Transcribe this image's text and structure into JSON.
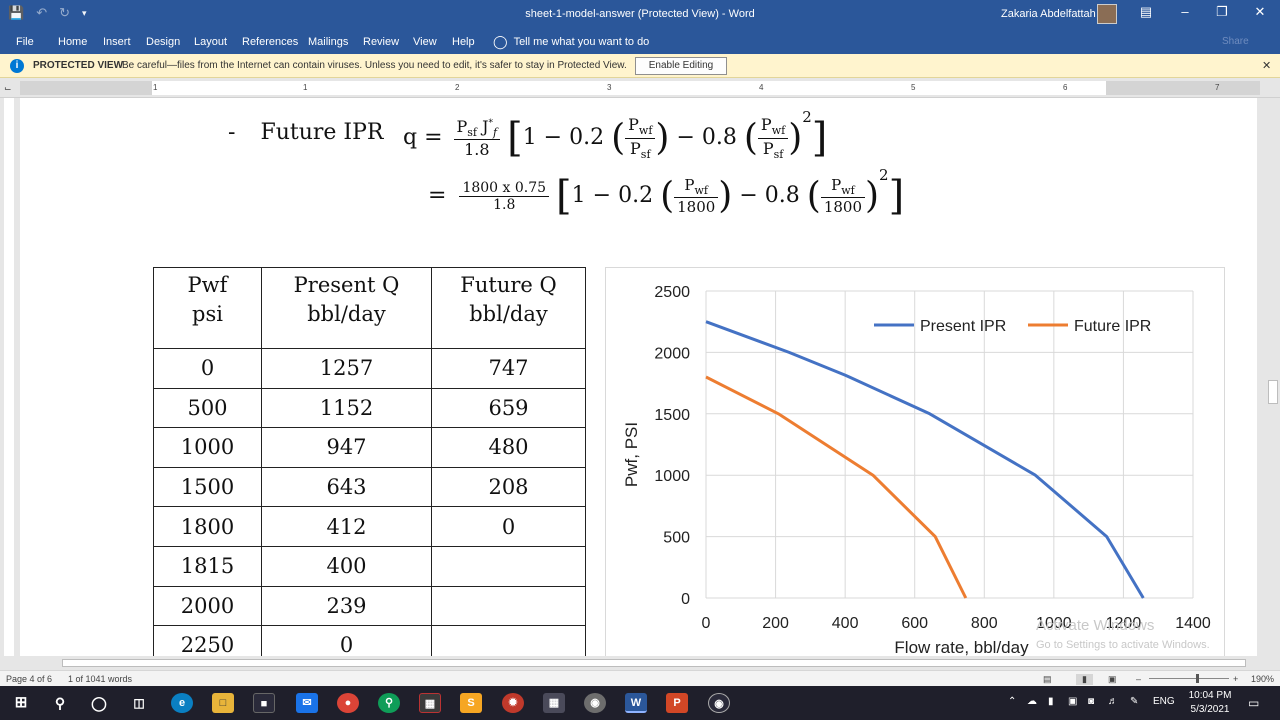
{
  "window": {
    "title": "sheet-1-model-answer (Protected View)  -  Word",
    "user": "Zakaria Abdelfattah"
  },
  "ribbon": {
    "tabs": [
      "File",
      "Home",
      "Insert",
      "Design",
      "Layout",
      "References",
      "Mailings",
      "Review",
      "View",
      "Help"
    ],
    "tell_me": "Tell me what you want to do",
    "share": "Share"
  },
  "protected_bar": {
    "label": "PROTECTED VIEW",
    "message": "Be careful—files from the Internet can contain viruses. Unless you need to edit, it's safer to stay in Protected View.",
    "enable_button": "Enable Editing"
  },
  "ruler": {
    "numbers": [
      "1",
      "1",
      "2",
      "3",
      "4",
      "5",
      "6",
      "7"
    ]
  },
  "document": {
    "bullet": "-",
    "heading": "Future IPR",
    "formula1": {
      "lhs": "q =",
      "num": "P",
      "num_sub": "sf",
      "num_var": " J",
      "num_star": "*",
      "num_f": "f",
      "den": "1.8",
      "body_a": "1 − 0.2",
      "body_b": "− 0.8",
      "ratio_num": "P",
      "ratio_num_sub": "wf",
      "ratio_den": "P",
      "ratio_den_sub": "sf",
      "power": "2"
    },
    "formula2": {
      "lhs": "=",
      "num": "1800 x 0.75",
      "den": "1.8",
      "body_a": "1 − 0.2",
      "body_b": "− 0.8",
      "ratio_num": "P",
      "ratio_num_sub": "wf",
      "ratio_den": "1800",
      "power": "2"
    },
    "table": {
      "headers": [
        [
          "Pwf",
          "psi"
        ],
        [
          "Present Q",
          "bbl/day"
        ],
        [
          "Future Q",
          "bbl/day"
        ]
      ],
      "rows": [
        [
          "0",
          "1257",
          "747"
        ],
        [
          "500",
          "1152",
          "659"
        ],
        [
          "1000",
          "947",
          "480"
        ],
        [
          "1500",
          "643",
          "208"
        ],
        [
          "1800",
          "412",
          "0"
        ],
        [
          "1815",
          "400",
          ""
        ],
        [
          "2000",
          "239",
          ""
        ],
        [
          "2250",
          "0",
          ""
        ]
      ]
    }
  },
  "chart_data": {
    "type": "line",
    "title": "",
    "xlabel": "Flow rate, bbl/day",
    "ylabel": "Pwf, PSI",
    "xlim": [
      0,
      1400
    ],
    "ylim": [
      0,
      2500
    ],
    "xticks": [
      0,
      200,
      400,
      600,
      800,
      1000,
      1200,
      1400
    ],
    "yticks": [
      0,
      500,
      1000,
      1500,
      2000,
      2500
    ],
    "grid": true,
    "legend": "top-right",
    "series": [
      {
        "name": "Present IPR",
        "color": "#4472c4",
        "points": [
          [
            0,
            2250
          ],
          [
            239,
            2000
          ],
          [
            400,
            1815
          ],
          [
            412,
            1800
          ],
          [
            643,
            1500
          ],
          [
            947,
            1000
          ],
          [
            1152,
            500
          ],
          [
            1257,
            0
          ]
        ]
      },
      {
        "name": "Future IPR",
        "color": "#ed7d31",
        "points": [
          [
            0,
            1800
          ],
          [
            208,
            1500
          ],
          [
            480,
            1000
          ],
          [
            659,
            500
          ],
          [
            747,
            0
          ]
        ]
      }
    ]
  },
  "statusbar": {
    "page": "Page 4 of 6",
    "words": "1 of 1041 words",
    "zoom": "190%"
  },
  "watermark": {
    "line1": "Activate Windows",
    "line2": "Go to Settings to activate Windows."
  },
  "taskbar": {
    "time": "10:04 PM",
    "date": "5/3/2021",
    "lang": "ENG"
  }
}
